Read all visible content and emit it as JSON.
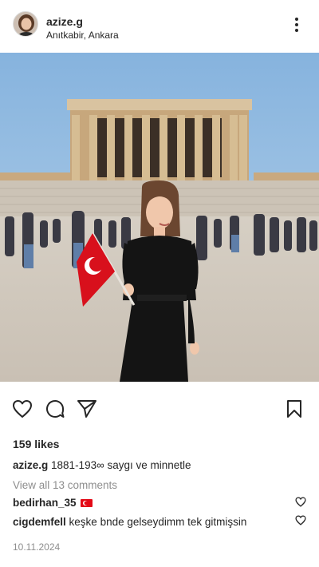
{
  "post": {
    "username": "azize.g",
    "location": "Anıtkabir, Ankara",
    "likes_text": "159 likes",
    "caption_user": "azize.g",
    "caption_text": "1881-193∞ saygı ve minnetle",
    "view_comments": "View all 13 comments",
    "comments": [
      {
        "user": "bedirhan_35",
        "text": ""
      },
      {
        "user": "cigdemfell",
        "text": "keşke bnde gelseydimm tek gitmişsin"
      }
    ],
    "date": "10.11.2024"
  },
  "icons": {
    "more": "more-options-icon",
    "like": "heart-icon",
    "comment": "comment-icon",
    "share": "send-icon",
    "save": "bookmark-icon",
    "flag": "turkey-flag-emoji"
  },
  "colors": {
    "text": "#262626",
    "muted": "#8e8e8e",
    "flag_red": "#e30a17"
  }
}
